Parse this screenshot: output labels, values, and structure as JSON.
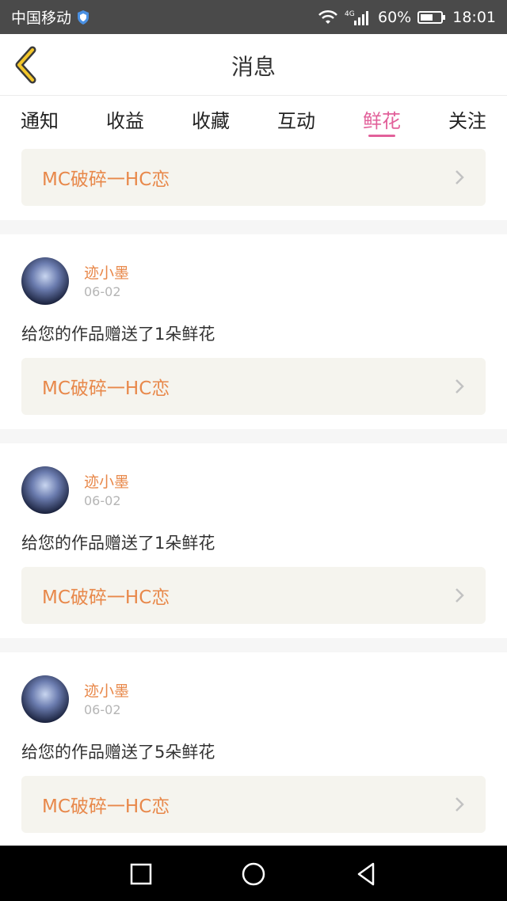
{
  "status_bar": {
    "carrier": "中国移动",
    "network": "4G",
    "battery": "60%",
    "time": "18:01"
  },
  "header": {
    "title": "消息"
  },
  "tabs": [
    {
      "label": "通知",
      "active": false
    },
    {
      "label": "收益",
      "active": false
    },
    {
      "label": "收藏",
      "active": false
    },
    {
      "label": "互动",
      "active": false
    },
    {
      "label": "鲜花",
      "active": true
    },
    {
      "label": "关注",
      "active": false
    }
  ],
  "first_link": {
    "label": "MC破碎一HC恋"
  },
  "messages": [
    {
      "user": "迹小墨",
      "date": "06-02",
      "text": "给您的作品赠送了1朵鲜花",
      "link": "MC破碎一HC恋"
    },
    {
      "user": "迹小墨",
      "date": "06-02",
      "text": "给您的作品赠送了1朵鲜花",
      "link": "MC破碎一HC恋"
    },
    {
      "user": "迹小墨",
      "date": "06-02",
      "text": "给您的作品赠送了5朵鲜花",
      "link": "MC破碎一HC恋"
    }
  ],
  "colors": {
    "accent": "#e2609a",
    "link_text": "#e8884a",
    "card_bg": "#f5f4ee"
  }
}
